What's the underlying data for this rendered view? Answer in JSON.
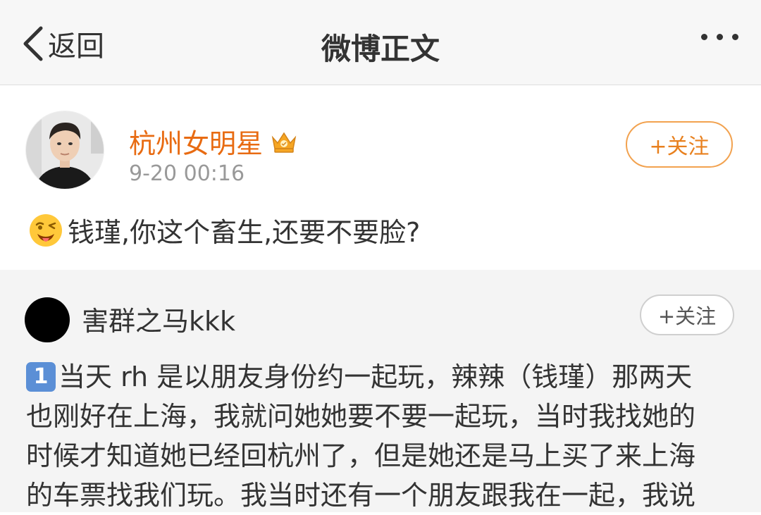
{
  "nav": {
    "back_label": "返回",
    "title": "微博正文"
  },
  "post": {
    "username": "杭州女明星",
    "time": "9-20 00:16",
    "follow_label": "+关注",
    "text": "钱瑾,你这个畜生,还要不要脸?"
  },
  "repost": {
    "username": "害群之马kkk",
    "follow_label": "+关注",
    "keycap": "1",
    "lines": [
      "当天 rh 是以朋友身份约一起玩，辣辣（钱瑾）那两天",
      "也刚好在上海，我就问她她要不要一起玩，当时我找她的",
      "时候才知道她已经回杭州了，但是她还是马上买了来上海",
      "的车票找我们玩。我当时还有一个朋友跟我在一起，我说"
    ]
  },
  "colors": {
    "accent": "#e8801e",
    "username": "#e86b12",
    "keycap": "#5b8fd6"
  }
}
